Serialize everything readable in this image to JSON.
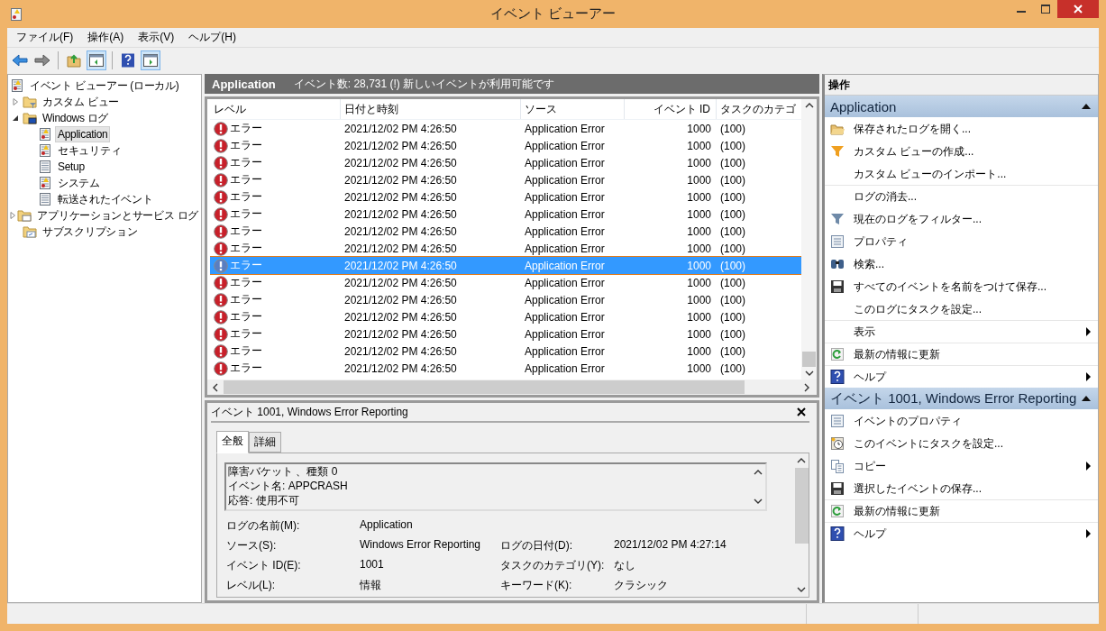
{
  "window": {
    "title": "イベント ビューアー"
  },
  "menu": [
    "ファイル(F)",
    "操作(A)",
    "表示(V)",
    "ヘルプ(H)"
  ],
  "toolbar": [
    {
      "kind": "back",
      "pressed": false
    },
    {
      "kind": "forward",
      "pressed": false
    },
    {
      "kind": "up",
      "pressed": false
    },
    {
      "kind": "tree-pane",
      "pressed": true
    },
    {
      "kind": "help",
      "pressed": false
    },
    {
      "kind": "action-pane",
      "pressed": true
    }
  ],
  "tree": [
    {
      "label": "イベント ビューアー (ローカル)",
      "kind": "root",
      "selected": false,
      "children": [
        {
          "label": "カスタム ビュー",
          "kind": "filter-folder",
          "expanded": false,
          "selected": false
        },
        {
          "label": "Windows ログ",
          "kind": "pc-folder",
          "expanded": true,
          "selected": false,
          "children": [
            {
              "label": "Application",
              "kind": "alert-log",
              "selected": true
            },
            {
              "label": "セキュリティ",
              "kind": "alert-log",
              "selected": false
            },
            {
              "label": "Setup",
              "kind": "log",
              "selected": false
            },
            {
              "label": "システム",
              "kind": "alert-log",
              "selected": false
            },
            {
              "label": "転送されたイベント",
              "kind": "log",
              "selected": false
            }
          ]
        },
        {
          "label": "アプリケーションとサービス ログ",
          "kind": "window-folder",
          "expanded": false,
          "selected": false
        },
        {
          "label": "サブスクリプション",
          "kind": "subscription",
          "selected": false
        }
      ]
    }
  ],
  "log_header": {
    "title": "Application",
    "summary": "イベント数: 28,731 (!) 新しいイベントが利用可能です"
  },
  "table": {
    "columns": [
      "レベル",
      "日付と時刻",
      "ソース",
      "イベント ID",
      "タスクのカテゴ"
    ],
    "rows": [
      {
        "level": "エラー",
        "date": "2021/12/02 PM 4:26:50",
        "source": "Application Error",
        "event_id": "1000",
        "category": "(100)",
        "selected": false
      },
      {
        "level": "エラー",
        "date": "2021/12/02 PM 4:26:50",
        "source": "Application Error",
        "event_id": "1000",
        "category": "(100)",
        "selected": false
      },
      {
        "level": "エラー",
        "date": "2021/12/02 PM 4:26:50",
        "source": "Application Error",
        "event_id": "1000",
        "category": "(100)",
        "selected": false
      },
      {
        "level": "エラー",
        "date": "2021/12/02 PM 4:26:50",
        "source": "Application Error",
        "event_id": "1000",
        "category": "(100)",
        "selected": false
      },
      {
        "level": "エラー",
        "date": "2021/12/02 PM 4:26:50",
        "source": "Application Error",
        "event_id": "1000",
        "category": "(100)",
        "selected": false
      },
      {
        "level": "エラー",
        "date": "2021/12/02 PM 4:26:50",
        "source": "Application Error",
        "event_id": "1000",
        "category": "(100)",
        "selected": false
      },
      {
        "level": "エラー",
        "date": "2021/12/02 PM 4:26:50",
        "source": "Application Error",
        "event_id": "1000",
        "category": "(100)",
        "selected": false
      },
      {
        "level": "エラー",
        "date": "2021/12/02 PM 4:26:50",
        "source": "Application Error",
        "event_id": "1000",
        "category": "(100)",
        "selected": false
      },
      {
        "level": "エラー",
        "date": "2021/12/02 PM 4:26:50",
        "source": "Application Error",
        "event_id": "1000",
        "category": "(100)",
        "selected": true
      },
      {
        "level": "エラー",
        "date": "2021/12/02 PM 4:26:50",
        "source": "Application Error",
        "event_id": "1000",
        "category": "(100)",
        "selected": false
      },
      {
        "level": "エラー",
        "date": "2021/12/02 PM 4:26:50",
        "source": "Application Error",
        "event_id": "1000",
        "category": "(100)",
        "selected": false
      },
      {
        "level": "エラー",
        "date": "2021/12/02 PM 4:26:50",
        "source": "Application Error",
        "event_id": "1000",
        "category": "(100)",
        "selected": false
      },
      {
        "level": "エラー",
        "date": "2021/12/02 PM 4:26:50",
        "source": "Application Error",
        "event_id": "1000",
        "category": "(100)",
        "selected": false
      },
      {
        "level": "エラー",
        "date": "2021/12/02 PM 4:26:50",
        "source": "Application Error",
        "event_id": "1000",
        "category": "(100)",
        "selected": false
      },
      {
        "level": "エラー",
        "date": "2021/12/02 PM 4:26:50",
        "source": "Application Error",
        "event_id": "1000",
        "category": "(100)",
        "selected": false
      }
    ]
  },
  "detail": {
    "title": "イベント 1001, Windows Error Reporting",
    "tabs": [
      {
        "label": "全般",
        "selected": true
      },
      {
        "label": "詳細",
        "selected": false
      }
    ],
    "description": [
      "障害バケット 、種類 0",
      "イベント名: APPCRASH",
      "応答: 使用不可"
    ],
    "fields": [
      [
        {
          "label": "ログの名前(M):",
          "value": "Application"
        }
      ],
      [
        {
          "label": "ソース(S):",
          "value": "Windows Error Reporting"
        },
        {
          "label": "ログの日付(D):",
          "value": "2021/12/02 PM 4:27:14"
        }
      ],
      [
        {
          "label": "イベント ID(E):",
          "value": "1001"
        },
        {
          "label": "タスクのカテゴリ(Y):",
          "value": "なし"
        }
      ],
      [
        {
          "label": "レベル(L):",
          "value": "情報"
        },
        {
          "label": "キーワード(K):",
          "value": "クラシック"
        }
      ]
    ]
  },
  "actions": {
    "title": "操作",
    "sections": [
      {
        "title": "Application",
        "expanded": true,
        "items": [
          {
            "label": "保存されたログを開く...",
            "kind": "open",
            "submenu": false,
            "divider_before": false
          },
          {
            "label": "カスタム ビューの作成...",
            "kind": "filter-new",
            "submenu": false,
            "divider_before": false
          },
          {
            "label": "カスタム ビューのインポート...",
            "kind": "none",
            "submenu": false,
            "divider_before": false
          },
          {
            "label": "ログの消去...",
            "kind": "none",
            "submenu": false,
            "divider_before": true
          },
          {
            "label": "現在のログをフィルター...",
            "kind": "filter",
            "submenu": false,
            "divider_before": false
          },
          {
            "label": "プロパティ",
            "kind": "properties",
            "submenu": false,
            "divider_before": false
          },
          {
            "label": "検索...",
            "kind": "find",
            "submenu": false,
            "divider_before": false
          },
          {
            "label": "すべてのイベントを名前をつけて保存...",
            "kind": "save",
            "submenu": false,
            "divider_before": false
          },
          {
            "label": "このログにタスクを設定...",
            "kind": "none",
            "submenu": false,
            "divider_before": false
          },
          {
            "label": "表示",
            "kind": "none",
            "submenu": true,
            "divider_before": true
          },
          {
            "label": "最新の情報に更新",
            "kind": "refresh",
            "submenu": false,
            "divider_before": true
          },
          {
            "label": "ヘルプ",
            "kind": "help",
            "submenu": true,
            "divider_before": true
          }
        ]
      },
      {
        "title": "イベント 1001, Windows Error Reporting",
        "expanded": true,
        "items": [
          {
            "label": "イベントのプロパティ",
            "kind": "properties",
            "submenu": false,
            "divider_before": false
          },
          {
            "label": "このイベントにタスクを設定...",
            "kind": "task",
            "submenu": false,
            "divider_before": false
          },
          {
            "label": "コピー",
            "kind": "copy",
            "submenu": true,
            "divider_before": false
          },
          {
            "label": "選択したイベントの保存...",
            "kind": "save",
            "submenu": false,
            "divider_before": false
          },
          {
            "label": "最新の情報に更新",
            "kind": "refresh",
            "submenu": false,
            "divider_before": true
          },
          {
            "label": "ヘルプ",
            "kind": "help",
            "submenu": true,
            "divider_before": true
          }
        ]
      }
    ]
  }
}
